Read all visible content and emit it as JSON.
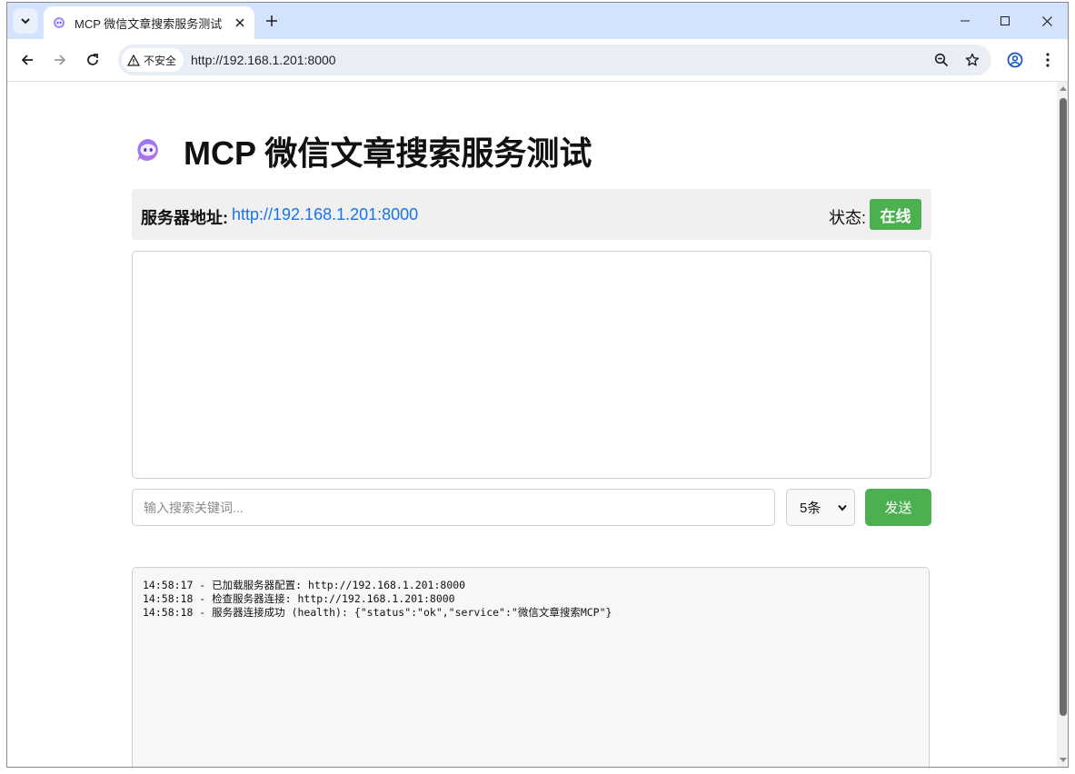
{
  "browser": {
    "tab_title": "MCP 微信文章搜索服务测试",
    "security_label": "不安全",
    "url": "http://192.168.1.201:8000"
  },
  "page": {
    "title": "MCP 微信文章搜索服务测试",
    "server_label": "服务器地址:",
    "server_url": "http://192.168.1.201:8000",
    "status_label": "状态:",
    "status_value": "在线",
    "status_color": "#4caf50"
  },
  "search": {
    "placeholder": "输入搜索关键词...",
    "count_selected": "5条",
    "send_label": "发送"
  },
  "log": {
    "lines": [
      "14:58:17 - 已加载服务器配置: http://192.168.1.201:8000",
      "14:58:18 - 检查服务器连接: http://192.168.1.201:8000",
      "14:58:18 - 服务器连接成功 (health): {\"status\":\"ok\",\"service\":\"微信文章搜索MCP\"}"
    ]
  },
  "icons": {
    "favicon": "chat-bot-icon",
    "title_icon": "chat-bot-icon"
  },
  "colors": {
    "accent_green": "#4caf50",
    "link_blue": "#1a73e8",
    "tabstrip": "#d3e3fd"
  }
}
